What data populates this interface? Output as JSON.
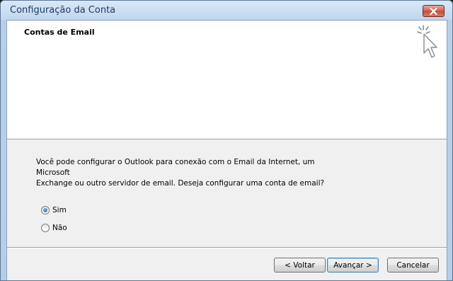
{
  "window": {
    "title": "Configuração da Conta",
    "close_icon": "close-icon"
  },
  "header": {
    "title": "Contas de Email",
    "icon": "wizard-cursor-icon"
  },
  "body": {
    "question_line1": "Você pode configurar o Outlook para conexão com o Email da Internet, um Microsoft",
    "question_line2": "Exchange ou outro servidor de email. Deseja configurar uma conta de email?",
    "options": [
      {
        "label": "Sim",
        "selected": true
      },
      {
        "label": "Não",
        "selected": false
      }
    ]
  },
  "buttons": {
    "back": "< Voltar",
    "next": "Avançar >",
    "cancel": "Cancelar"
  },
  "colors": {
    "close_button": "#c44a35",
    "title_text": "#1e395b",
    "radio_selected": "#1d5fb0"
  }
}
